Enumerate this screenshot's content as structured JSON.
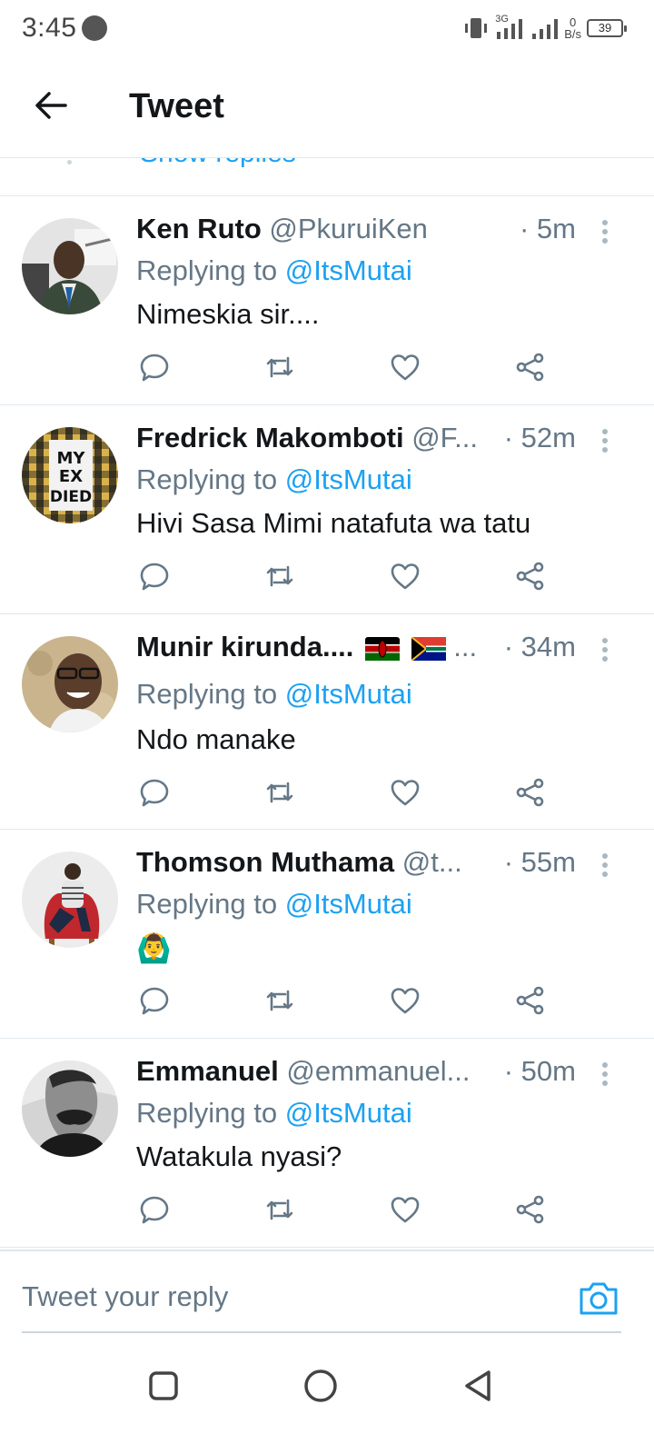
{
  "status_bar": {
    "time": "3:45",
    "network_label": "3G",
    "speed_value": "0",
    "speed_unit": "B/s",
    "battery": "39"
  },
  "header": {
    "title": "Tweet"
  },
  "thread": {
    "show_replies_label": "Show replies"
  },
  "replies": [
    {
      "name": "Ken Ruto",
      "handle": "@PkuruiKen",
      "time": "· 5m",
      "replying_prefix": "Replying to",
      "replying_to": "@ItsMutai",
      "text": "Nimeskia sir....",
      "avatar_colors": [
        "#d8d8d8",
        "#3b3b3b"
      ]
    },
    {
      "name": "Fredrick Makomboti",
      "handle": "@F...",
      "time": "· 52m",
      "replying_prefix": "Replying to",
      "replying_to": "@ItsMutai",
      "text": "Hivi Sasa Mimi natafuta wa tatu",
      "avatar_colors": [
        "#d9b24a",
        "#1a1a1a"
      ],
      "avatar_text": "MY EX DIED"
    },
    {
      "name": "Munir kirunda....",
      "handle": "...",
      "time": "· 34m",
      "replying_prefix": "Replying to",
      "replying_to": "@ItsMutai",
      "text": "Ndo manake",
      "avatar_colors": [
        "#c9b48e",
        "#5a3d2b"
      ],
      "flags": [
        "kenya-flag-icon",
        "south-africa-flag-icon"
      ]
    },
    {
      "name": "Thomson Muthama",
      "handle": "@t...",
      "time": "· 55m",
      "replying_prefix": "Replying to",
      "replying_to": "@ItsMutai",
      "text": "🙆‍♂️",
      "avatar_colors": [
        "#e8e8e8",
        "#c0282d"
      ]
    },
    {
      "name": "Emmanuel",
      "handle": "@emmanuel...",
      "time": "· 50m",
      "replying_prefix": "Replying to",
      "replying_to": "@ItsMutai",
      "text": "Watakula nyasi?",
      "avatar_colors": [
        "#bdbdbd",
        "#222222"
      ]
    }
  ],
  "composer": {
    "placeholder": "Tweet your reply"
  },
  "colors": {
    "accent": "#1da1f2",
    "icon_gray": "#657786",
    "divider": "#e1e8ed"
  }
}
